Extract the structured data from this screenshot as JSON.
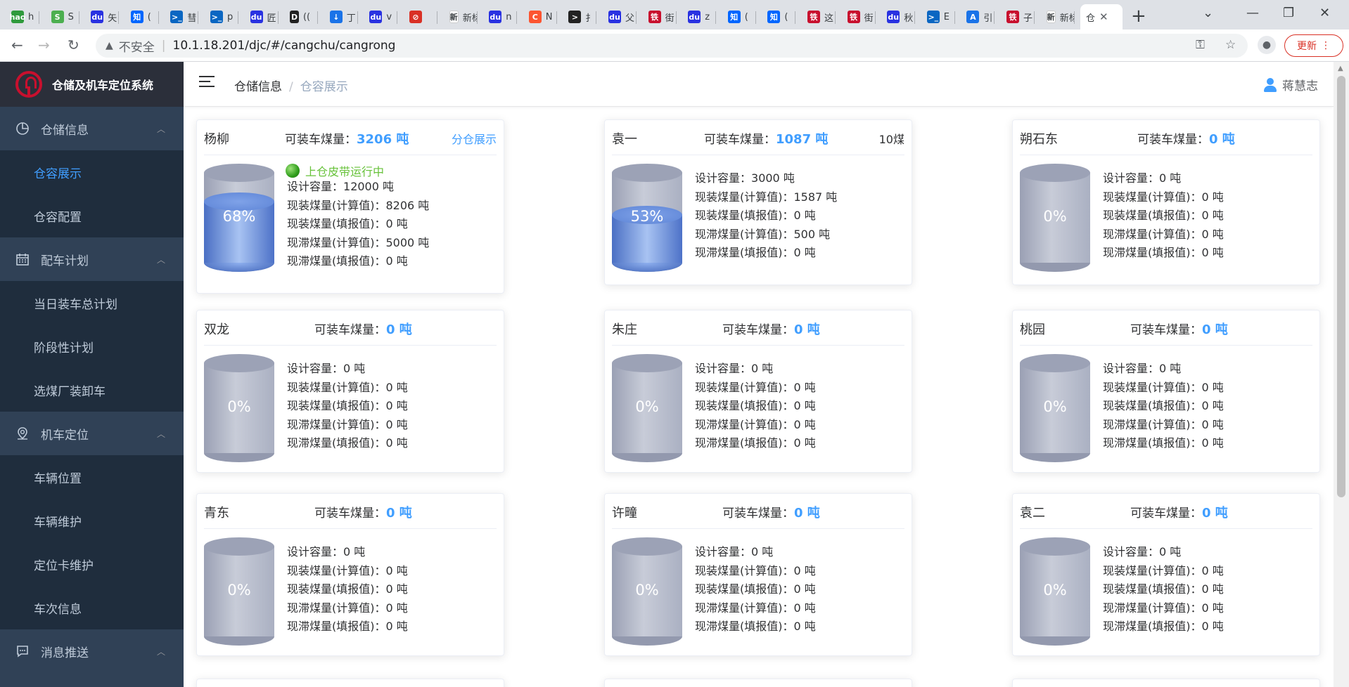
{
  "browser": {
    "tabs": [
      {
        "fav": "hao",
        "color": "#2f9a3c",
        "title": "h"
      },
      {
        "fav": "S",
        "color": "#4caf50",
        "title": "S"
      },
      {
        "fav": "du",
        "color": "#2932e1",
        "title": "矢"
      },
      {
        "fav": "知",
        "color": "#0066ff",
        "title": "("
      },
      {
        "fav": ">_",
        "color": "#0a66c2",
        "title": "彗"
      },
      {
        "fav": ">_",
        "color": "#0a66c2",
        "title": "p"
      },
      {
        "fav": "du",
        "color": "#2932e1",
        "title": "匠"
      },
      {
        "fav": "D",
        "color": "#222222",
        "title": "(("
      },
      {
        "fav": "↓",
        "color": "#1a73e8",
        "title": "丁"
      },
      {
        "fav": "du",
        "color": "#2932e1",
        "title": "v"
      },
      {
        "fav": "⊘",
        "color": "#d93025",
        "title": ""
      },
      {
        "fav": "新",
        "color": "#ffffff",
        "title": "新标"
      },
      {
        "fav": "du",
        "color": "#2932e1",
        "title": "n"
      },
      {
        "fav": "C",
        "color": "#fc5531",
        "title": "N"
      },
      {
        "fav": ">",
        "color": "#222222",
        "title": "扌"
      },
      {
        "fav": "du",
        "color": "#2932e1",
        "title": "父"
      },
      {
        "fav": "铁",
        "color": "#c8102e",
        "title": "街"
      },
      {
        "fav": "du",
        "color": "#2932e1",
        "title": "z"
      },
      {
        "fav": "知",
        "color": "#0066ff",
        "title": "("
      },
      {
        "fav": "知",
        "color": "#0066ff",
        "title": "("
      },
      {
        "fav": "铁",
        "color": "#c8102e",
        "title": "这"
      },
      {
        "fav": "铁",
        "color": "#c8102e",
        "title": "街"
      },
      {
        "fav": "du",
        "color": "#2932e1",
        "title": "秋"
      },
      {
        "fav": ">_",
        "color": "#0a66c2",
        "title": "E"
      },
      {
        "fav": "A",
        "color": "#1a73e8",
        "title": "引"
      },
      {
        "fav": "铁",
        "color": "#c8102e",
        "title": "子"
      },
      {
        "fav": "新",
        "color": "#ffffff",
        "title": "新标"
      }
    ],
    "active_tab_title": "仓",
    "address_insecure": "不安全",
    "address_url": "10.1.18.201/djc/#/cangchu/cangrong",
    "update_label": "更新"
  },
  "sidebar": {
    "title": "仓储及机车定位系统",
    "groups": [
      {
        "label": "仓储信息",
        "items": [
          "仓容展示",
          "仓容配置"
        ]
      },
      {
        "label": "配车计划",
        "items": [
          "当日装车总计划",
          "阶段性计划",
          "选煤厂装卸车"
        ]
      },
      {
        "label": "机车定位",
        "items": [
          "车辆位置",
          "车辆维护",
          "定位卡维护",
          "车次信息"
        ]
      },
      {
        "label": "消息推送",
        "items": []
      }
    ]
  },
  "header": {
    "breadcrumb": [
      "仓储信息",
      "仓容展示"
    ],
    "breadcrumb_sep": "/",
    "user": "蒋慧志"
  },
  "labels": {
    "loadable": "可装车煤量：",
    "design": "设计容量：",
    "cur_calc": "现装煤量(计算值)：",
    "cur_fill": "现装煤量(填报值)：",
    "stuck_calc": "现滞煤量(计算值)：",
    "stuck_fill": "现滞煤量(填报值)："
  },
  "cards": [
    {
      "name": "杨柳",
      "loadable": "3206 吨",
      "extra": "分仓展示",
      "extra_link": true,
      "status": "上仓皮带运行中",
      "percent": 68,
      "pct_label": "68%",
      "design": "12000 吨",
      "cur_calc": "8206 吨",
      "cur_fill": "0 吨",
      "stuck_calc": "5000 吨",
      "stuck_fill": "0 吨"
    },
    {
      "name": "袁一",
      "loadable": "1087 吨",
      "extra": "10煤",
      "extra_link": false,
      "status": "",
      "percent": 53,
      "pct_label": "53%",
      "design": "3000 吨",
      "cur_calc": "1587 吨",
      "cur_fill": "0 吨",
      "stuck_calc": "500 吨",
      "stuck_fill": "0 吨"
    },
    {
      "name": "朔石东",
      "loadable": "0 吨",
      "extra": "",
      "extra_link": false,
      "status": "",
      "percent": 0,
      "pct_label": "0%",
      "design": "0 吨",
      "cur_calc": "0 吨",
      "cur_fill": "0 吨",
      "stuck_calc": "0 吨",
      "stuck_fill": "0 吨"
    },
    {
      "name": "双龙",
      "loadable": "0 吨",
      "extra": "",
      "extra_link": false,
      "status": "",
      "percent": 0,
      "pct_label": "0%",
      "design": "0 吨",
      "cur_calc": "0 吨",
      "cur_fill": "0 吨",
      "stuck_calc": "0 吨",
      "stuck_fill": "0 吨"
    },
    {
      "name": "朱庄",
      "loadable": "0 吨",
      "extra": "",
      "extra_link": false,
      "status": "",
      "percent": 0,
      "pct_label": "0%",
      "design": "0 吨",
      "cur_calc": "0 吨",
      "cur_fill": "0 吨",
      "stuck_calc": "0 吨",
      "stuck_fill": "0 吨"
    },
    {
      "name": "桃园",
      "loadable": "0 吨",
      "extra": "",
      "extra_link": false,
      "status": "",
      "percent": 0,
      "pct_label": "0%",
      "design": "0 吨",
      "cur_calc": "0 吨",
      "cur_fill": "0 吨",
      "stuck_calc": "0 吨",
      "stuck_fill": "0 吨"
    },
    {
      "name": "青东",
      "loadable": "0 吨",
      "extra": "",
      "extra_link": false,
      "status": "",
      "percent": 0,
      "pct_label": "0%",
      "design": "0 吨",
      "cur_calc": "0 吨",
      "cur_fill": "0 吨",
      "stuck_calc": "0 吨",
      "stuck_fill": "0 吨"
    },
    {
      "name": "许疃",
      "loadable": "0 吨",
      "extra": "",
      "extra_link": false,
      "status": "",
      "percent": 0,
      "pct_label": "0%",
      "design": "0 吨",
      "cur_calc": "0 吨",
      "cur_fill": "0 吨",
      "stuck_calc": "0 吨",
      "stuck_fill": "0 吨"
    },
    {
      "name": "袁二",
      "loadable": "0 吨",
      "extra": "",
      "extra_link": false,
      "status": "",
      "percent": 0,
      "pct_label": "0%",
      "design": "0 吨",
      "cur_calc": "0 吨",
      "cur_fill": "0 吨",
      "stuck_calc": "0 吨",
      "stuck_fill": "0 吨"
    }
  ]
}
